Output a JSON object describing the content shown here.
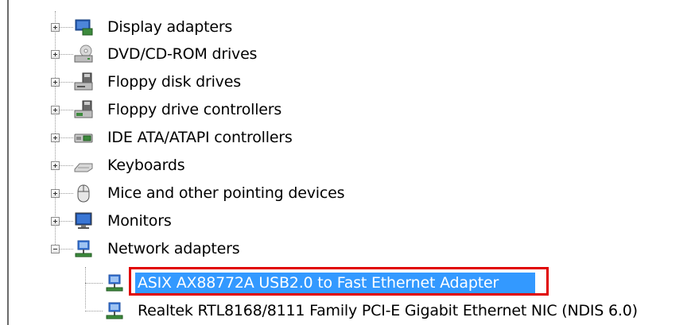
{
  "tree": {
    "categories": [
      {
        "label": "Display adapters",
        "icon": "display-adapter-icon",
        "expanded": false
      },
      {
        "label": "DVD/CD-ROM drives",
        "icon": "dvd-drive-icon",
        "expanded": false
      },
      {
        "label": "Floppy disk drives",
        "icon": "floppy-disk-icon",
        "expanded": false
      },
      {
        "label": "Floppy drive controllers",
        "icon": "floppy-controller-icon",
        "expanded": false
      },
      {
        "label": "IDE ATA/ATAPI controllers",
        "icon": "ide-controller-icon",
        "expanded": false
      },
      {
        "label": "Keyboards",
        "icon": "keyboard-icon",
        "expanded": false
      },
      {
        "label": "Mice and other pointing devices",
        "icon": "mouse-icon",
        "expanded": false
      },
      {
        "label": "Monitors",
        "icon": "monitor-icon",
        "expanded": false
      },
      {
        "label": "Network adapters",
        "icon": "network-adapter-icon",
        "expanded": true
      }
    ],
    "network_children": [
      {
        "label": "ASIX AX88772A USB2.0 to Fast Ethernet Adapter",
        "icon": "network-card-icon",
        "selected": true
      },
      {
        "label": "Realtek RTL8168/8111 Family PCI-E Gigabit Ethernet NIC (NDIS 6.0)",
        "icon": "network-card-icon",
        "selected": false
      }
    ]
  },
  "colors": {
    "selection": "#3399ff",
    "highlight_box": "#e00000",
    "tree_lines": "#9a9a9a"
  }
}
